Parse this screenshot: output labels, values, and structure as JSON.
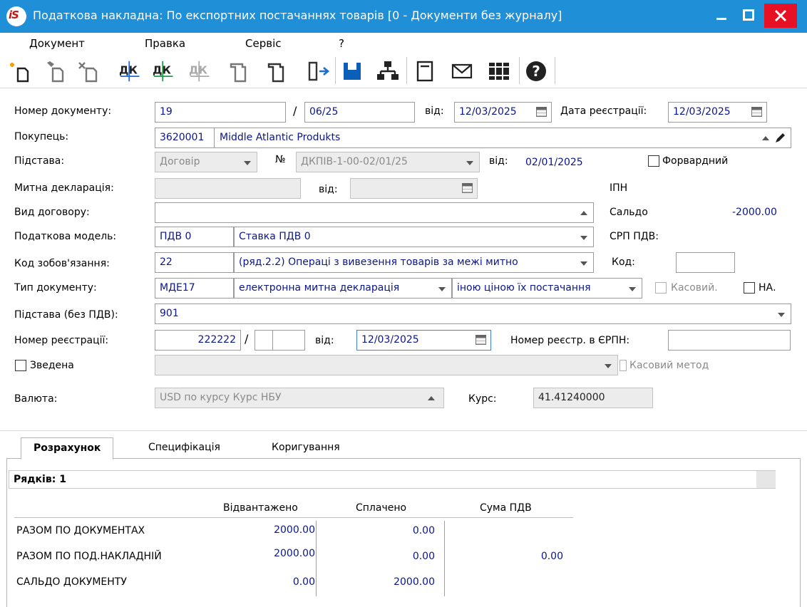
{
  "window": {
    "title": "Податкова накладна: По експортних  постачаннях товарів [0 - Документи без журналу]",
    "logo_text": "iS"
  },
  "menu": [
    "Документ",
    "Правка",
    "Сервіс",
    "?"
  ],
  "toolbar_icons": [
    "create-doc-icon",
    "edit-doc-icon",
    "delete-doc-icon",
    "debit-credit-icon",
    "debit-credit-green-icon",
    "debit-credit-disabled-icon",
    "copy-doc-icon",
    "copy-doc-2-icon",
    "exit-icon",
    "save-icon",
    "structure-icon",
    "form-icon",
    "mail-icon",
    "books-icon",
    "help-icon"
  ],
  "form": {
    "doc_number_label": "Номер документу:",
    "doc_number": "19",
    "doc_slash": "/",
    "doc_suffix": "06/25",
    "date_label": "від:",
    "date": "12/03/2025",
    "reg_date_label": "Дата реєстрації:",
    "reg_date": "12/03/2025",
    "buyer_label": "Покупець:",
    "buyer_code": "3620001",
    "buyer_name": "Middle Atlantic Produkts",
    "basis_label": "Підстава:",
    "basis_value": "Договір",
    "contract_no_label": "№",
    "contract_no": "ДКПІВ-1-00-02/01/25",
    "contract_date_label": "від:",
    "contract_date": "02/01/2025",
    "forward_label": "Форвардний",
    "customs_label": "Митна декларація:",
    "customs_date_label": "від:",
    "ipn_label": "ІПН",
    "contract_type_label": "Вид договору:",
    "balance_label": "Сальдо",
    "balance_value": "-2000.00",
    "tax_model_label": "Податкова модель:",
    "tax_model_code": "ПДВ  0",
    "tax_model_name": "Ставка ПДВ 0",
    "srp_label": "СРП ПДВ:",
    "obligation_label": "Код зобов'язання:",
    "obligation_code": "22",
    "obligation_name": "(ряд.2.2) Операці з вивезення товарів за межі митно",
    "code_label": "Код:",
    "doc_type_label": "Тип документу:",
    "doc_type_code": "МДЕ17",
    "doc_type_name": "електронна митна декларація",
    "doc_type_extra": "іною ціною їх постачання",
    "cash_label": "Касовий.",
    "na_label": "НА.",
    "basis_nonvat_label": "Підстава (без ПДВ):",
    "basis_nonvat_value": "901",
    "reg_number_label": "Номер реєстрації:",
    "reg_number": "222222",
    "reg_number_slash": "/",
    "reg_from_label": "від:",
    "reg_from_date": "12/03/2025",
    "erpn_label": "Номер реєстр. в ЄРПН:",
    "consolidated_label": "Зведена",
    "cash_method_label": "Касовий метод",
    "currency_label": "Валюта:",
    "currency_value": "USD по курсу Курс НБУ",
    "rate_label": "Курс:",
    "rate_value": "41.41240000"
  },
  "tabs": [
    "Розрахунок",
    "Специфікація",
    "Коригування"
  ],
  "calc": {
    "rows_label": "Рядків: 1",
    "columns": [
      "Відвантажено",
      "Сплачено",
      "Сума ПДВ"
    ],
    "rows": [
      {
        "label": "РАЗОМ ПО ДОКУМЕНТАХ",
        "shipped": "2000.00",
        "paid": "0.00",
        "vat": ""
      },
      {
        "label": "РАЗОМ ПО ПОД.НАКЛАДНІЙ",
        "shipped": "2000.00",
        "paid": "0.00",
        "vat": "0.00"
      },
      {
        "label": "САЛЬДО ДОКУМЕНТУ",
        "shipped": "0.00",
        "paid": "2000.00",
        "vat": ""
      }
    ]
  }
}
